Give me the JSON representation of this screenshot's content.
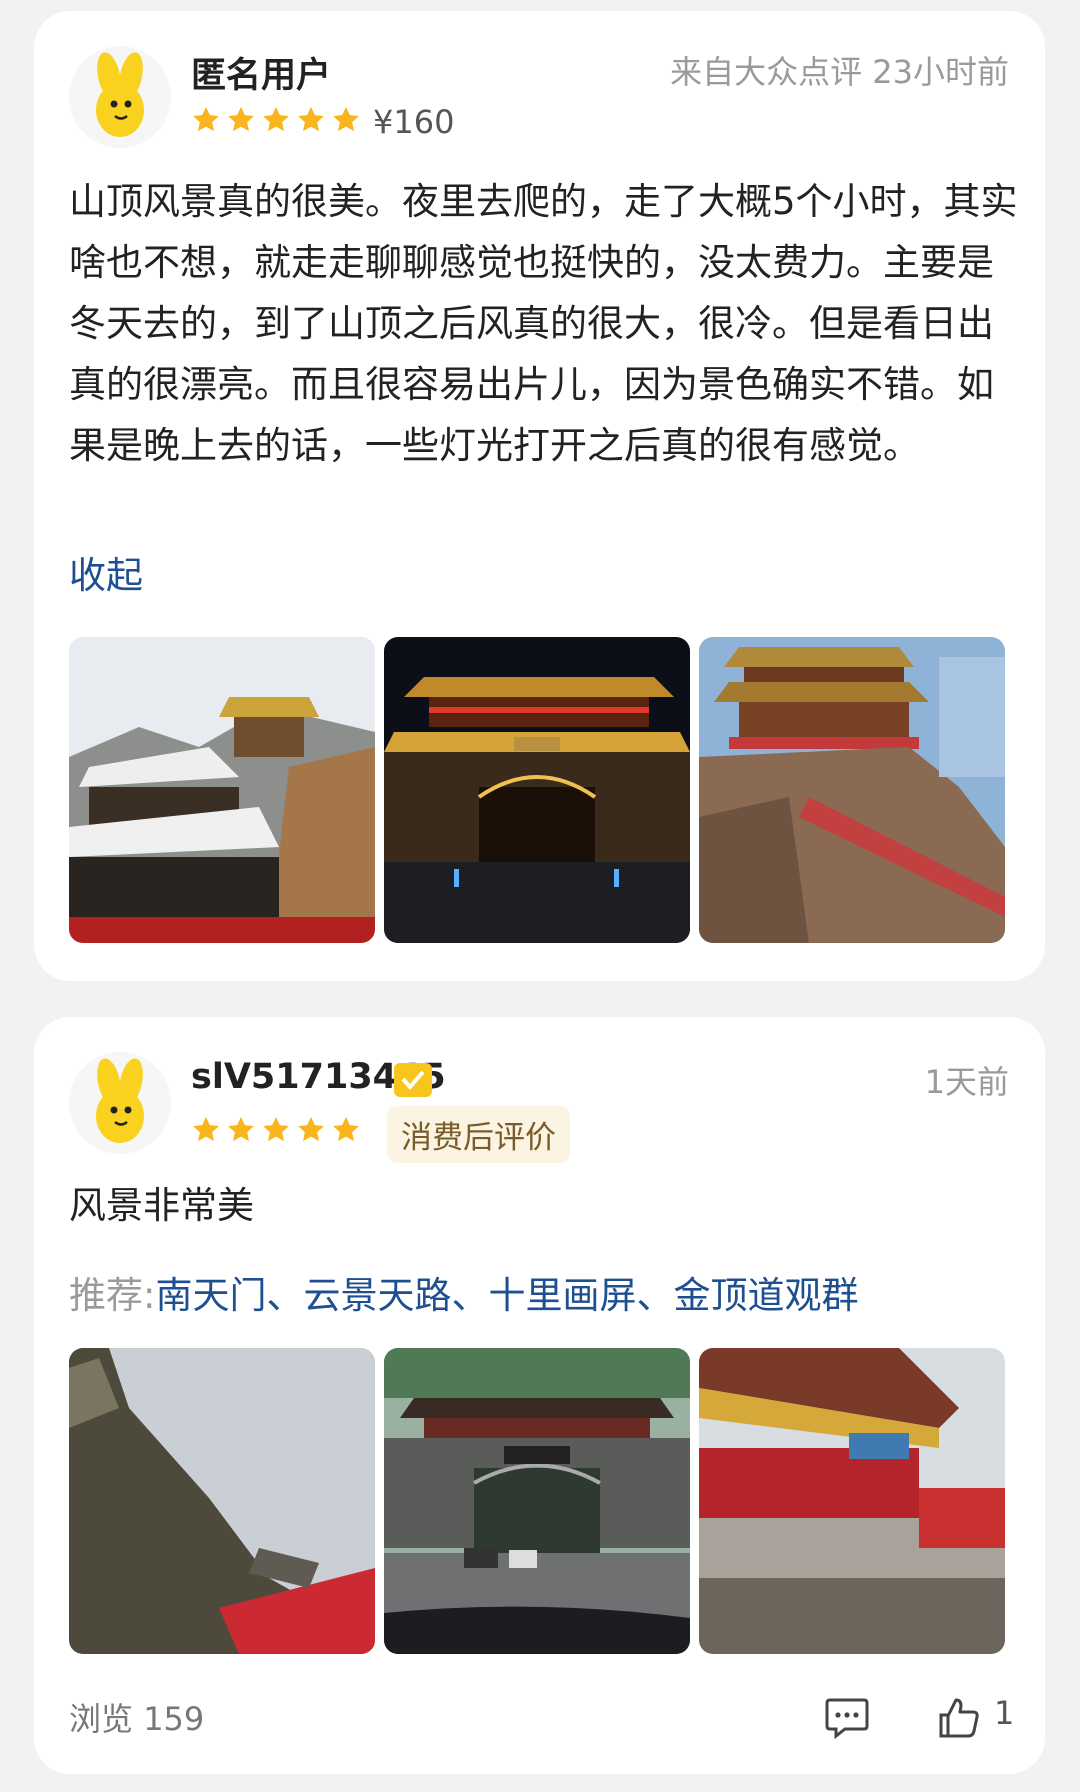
{
  "review1": {
    "username": "匿名用户",
    "source_time": "来自大众点评 23小时前",
    "rating": 5,
    "price": "¥160",
    "text": "山顶风景真的很美。夜里去爬的，走了大概5个小时，其实啥也不想，就走走聊聊感觉也挺快的，没太费力。主要是冬天去的，到了山顶之后风真的很大，很冷。但是看日出真的很漂亮。而且很容易出片儿，因为景色确实不错。如果是晚上去的话，一些灯光打开之后真的很有感觉。",
    "collapse_label": "收起",
    "photos": [
      "snowy-temple-photo",
      "night-gate-photo",
      "cliff-temple-photo"
    ]
  },
  "review2": {
    "username": "slV51713445",
    "time": "1天前",
    "rating": 5,
    "tag": "消费后评价",
    "text": "风景非常美",
    "recommend_label": "推荐:",
    "recommend_items": [
      "南天门",
      "云景天路",
      "十里画屏",
      "金顶道观群"
    ],
    "recommend_separator": "、",
    "photos": [
      "cliff-path-photo",
      "day-gate-photo",
      "red-ribbons-temple-photo"
    ],
    "views_label": "浏览",
    "views_count": "159",
    "likes_count": "1"
  },
  "colors": {
    "star": "#f9b51b",
    "link": "#1d4f91",
    "badge": "#f7c51c"
  },
  "icons": {
    "star": "star-icon",
    "verified": "verified-icon",
    "comment": "comment-icon",
    "like": "thumbs-up-icon"
  }
}
